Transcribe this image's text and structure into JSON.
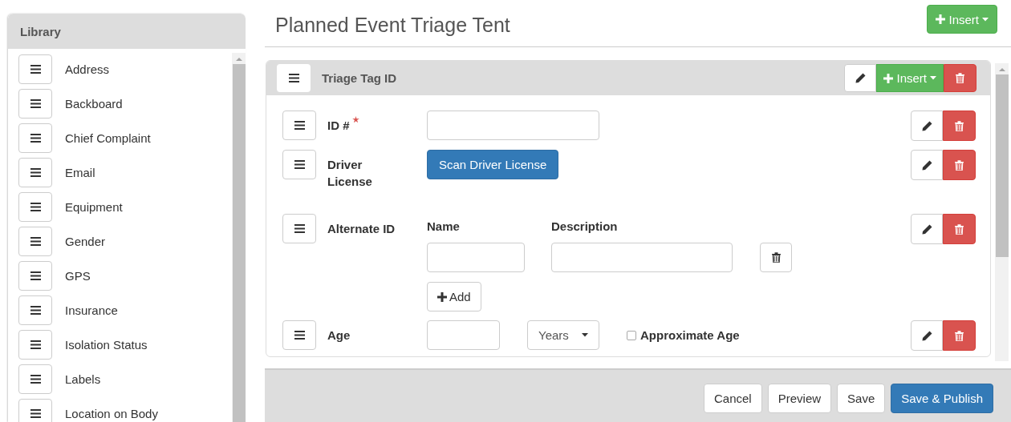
{
  "sidebar": {
    "title": "Library",
    "items": [
      {
        "label": "Address"
      },
      {
        "label": "Backboard"
      },
      {
        "label": "Chief Complaint"
      },
      {
        "label": "Email"
      },
      {
        "label": "Equipment"
      },
      {
        "label": "Gender"
      },
      {
        "label": "GPS"
      },
      {
        "label": "Insurance"
      },
      {
        "label": "Isolation Status"
      },
      {
        "label": "Labels"
      },
      {
        "label": "Location on Body"
      }
    ]
  },
  "page": {
    "title": "Planned Event Triage Tent",
    "insert_button": "Insert"
  },
  "section": {
    "title": "Triage Tag ID",
    "insert_button": "Insert",
    "fields": [
      {
        "kind": "text",
        "label": "ID #",
        "required": true
      },
      {
        "kind": "button",
        "label": "Driver License",
        "required": false,
        "button": "Scan Driver License"
      },
      {
        "kind": "table",
        "label": "Alternate ID",
        "required": false,
        "columns": [
          "Name",
          "Description"
        ],
        "add_button": "Add"
      },
      {
        "kind": "age",
        "label": "Age",
        "required": false,
        "unit": "Years",
        "checkbox": {
          "label": "Approximate Age",
          "checked": false
        }
      }
    ]
  },
  "footer": {
    "buttons": [
      {
        "label": "Cancel",
        "primary": false
      },
      {
        "label": "Preview",
        "primary": false
      },
      {
        "label": "Save",
        "primary": false
      },
      {
        "label": "Save & Publish",
        "primary": true
      }
    ]
  }
}
